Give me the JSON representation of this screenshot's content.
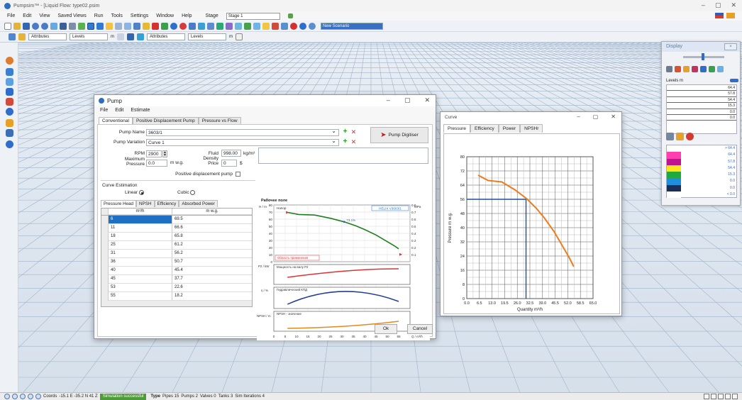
{
  "app": {
    "title": "Pumpsim™ - [Liquid Flow: type02.psim",
    "menus": [
      "File",
      "Edit",
      "View",
      "Saved Views",
      "Run",
      "Tools",
      "Settings",
      "Window",
      "Help"
    ],
    "stage_label": "Stage",
    "stage_value": "Stage 1",
    "scenario_value": "New Scenario",
    "toolbar2": {
      "attributes_1": "Attributes",
      "levels_1": "Levels",
      "attributes_2": "Attributes",
      "levels_2": "Levels",
      "m_unit": "m"
    }
  },
  "status": {
    "coords_label": "Coords",
    "coords_value": "-15.1 E  -35.2 N  41 Z",
    "simulation": "Simulation successful",
    "type_label": "Type",
    "pipes": "Pipes 15",
    "pumps": "Pumps 2",
    "valves": "Valves 0",
    "tanks": "Tanks 3",
    "iterations": "Sim Iterations 4"
  },
  "display_panel": {
    "title": "Display",
    "close_label": "×",
    "levels_title": "Levels m",
    "levels": [
      "64.4",
      "57.8",
      "54.4",
      "15.3",
      "0.0",
      "0.0"
    ],
    "colors": [
      "#ff3fb0",
      "#c0138e",
      "#ffe51a",
      "#21a93b",
      "#1f8fdc",
      "#1b2e56"
    ],
    "scale": [
      "> 64.4",
      "64.4",
      "57.8",
      "54.4",
      "15.3",
      "0.0",
      "0.0",
      "< 0.0"
    ]
  },
  "pump": {
    "title": "Pump",
    "menu": [
      "File",
      "Edit",
      "Estimate"
    ],
    "tabs": [
      "Conventional",
      "Positive Displacement Pump",
      "Pressure vs Flow"
    ],
    "pump_name_label": "Pump Name",
    "pump_name": "3603/1",
    "pump_variation_label": "Pump Variation",
    "pump_variation": "Curve 1",
    "digitiser_label": "Pump Digitiser",
    "rpm_label": "RPM",
    "rpm": "2900",
    "max_pressure_label": "Maximum Pressure",
    "max_pressure": "0.0",
    "max_pressure_unit": "m w.g.",
    "fluid_density_label": "Fluid Density",
    "fluid_density": "998.00",
    "fluid_density_unit": "kg/m³",
    "price_label": "Price",
    "price": "0",
    "price_unit": "$",
    "pd_pump_label": "Positive displacement pump",
    "curve_est_label": "Curve Estimation",
    "linear_label": "Linear",
    "cubic_label": "Cubic",
    "subtabs": [
      "Pressure Head",
      "NPSH",
      "Efficiency",
      "Absorbed Power"
    ],
    "grid_cols": [
      "m³/h",
      "m w.g."
    ],
    "grid_rows": [
      [
        "6",
        "69.5"
      ],
      [
        "11",
        "66.6"
      ],
      [
        "18",
        "65.8"
      ],
      [
        "25",
        "61.2"
      ],
      [
        "31",
        "56.2"
      ],
      [
        "36",
        "50.7"
      ],
      [
        "40",
        "45.4"
      ],
      [
        "45",
        "37.7"
      ],
      [
        "53",
        "22.6"
      ],
      [
        "55",
        "18.2"
      ]
    ],
    "ok_label": "Ok",
    "cancel_label": "Cancel"
  },
  "pump_chart": {
    "title": "Рабочее поле",
    "model": "HELIX V3603/1",
    "h_axis": "H / m",
    "mpa_axis": "MPa",
    "p2_axis": "P2 / kW",
    "eta_axis": "η / %",
    "npsh_axis": "NPSH / m",
    "x_unit": "Q / m³/h",
    "head_legend": "Напор",
    "region_legend": "Область применения",
    "power_legend": "Мощность на валу P2",
    "eff_legend": "Гидравлический КПД",
    "npsh_legend": "NPSH - значение",
    "bep_label": "73.1%",
    "h_ticks": [
      "80",
      "70",
      "60",
      "50",
      "40",
      "30",
      "20",
      "10",
      "0"
    ],
    "mpa_ticks": [
      "0.8",
      "0.7",
      "0.6",
      "0.5",
      "0.4",
      "0.3",
      "0.2",
      "0.1"
    ],
    "x_ticks": [
      "0",
      "5",
      "10",
      "15",
      "20",
      "25",
      "30",
      "35",
      "40",
      "45",
      "50",
      "55"
    ]
  },
  "curve_window": {
    "title": "Curve",
    "tabs": [
      "Pressure",
      "Efficiency",
      "Power",
      "NPSHr"
    ],
    "xlabel": "Quantity m³/h",
    "ylabel": "Pressure m w.g.",
    "y_ticks": [
      "80",
      "72",
      "64",
      "56",
      "48",
      "40",
      "32",
      "24",
      "16",
      "8",
      "0"
    ],
    "x_ticks": [
      "0.0",
      "6.5",
      "13.0",
      "19.5",
      "26.0",
      "32.5",
      "39.0",
      "45.5",
      "52.0",
      "58.5",
      "65.0"
    ]
  },
  "chart_data": [
    {
      "type": "line",
      "title": "",
      "xlabel": "Quantity m³/h",
      "ylabel": "Pressure m w.g.",
      "xlim": [
        0,
        65
      ],
      "ylim": [
        0,
        80
      ],
      "x": [
        6,
        11,
        18,
        25,
        31,
        36,
        40,
        45,
        53,
        55
      ],
      "series": [
        {
          "values": [
            69.5,
            66.6,
            65.8,
            61.2,
            56.2,
            50.7,
            45.4,
            37.7,
            22.6,
            18.2
          ],
          "color": "#f07b1a"
        }
      ],
      "operating_point": {
        "x": 30.5,
        "y": 56
      },
      "grid": true
    },
    {
      "type": "line",
      "title": "Рабочее поле",
      "xlabel": "Q / m³/h",
      "ylabel": "H / m",
      "xlim": [
        0,
        60
      ],
      "ylim": [
        0,
        80
      ],
      "x": [
        6,
        11,
        18,
        25,
        31,
        36,
        40,
        45,
        53,
        55
      ],
      "series": [
        {
          "name": "Напор",
          "values": [
            69.5,
            66.6,
            65.8,
            61.2,
            56.2,
            50.7,
            45.4,
            37.7,
            22.6,
            18.2
          ],
          "color": "#1f7f1f"
        }
      ],
      "grid": true
    }
  ]
}
